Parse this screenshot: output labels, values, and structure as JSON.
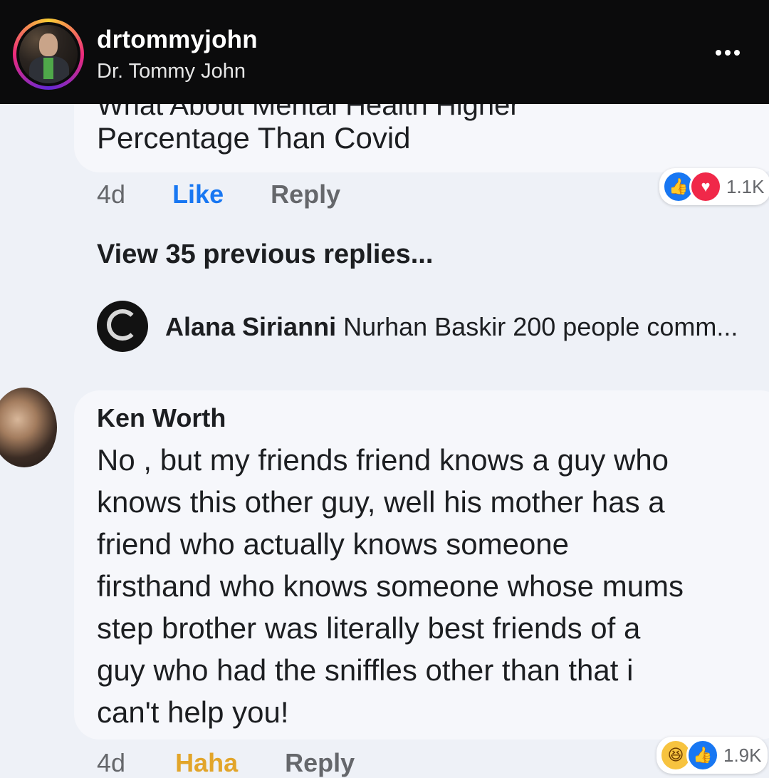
{
  "header": {
    "username": "drtommyjohn",
    "full_name": "Dr. Tommy John",
    "more_icon": "more-horizontal-icon"
  },
  "comment_top": {
    "cut_text": "What About Mental Health Higher",
    "text": "Percentage Than Covid",
    "time": "4d",
    "like_label": "Like",
    "reply_label": "Reply",
    "reaction_count": "1.1K",
    "reactions": [
      "like",
      "love"
    ]
  },
  "replies": {
    "view_previous": "View 35 previous replies..."
  },
  "reply_preview": {
    "author": "Alana Sirianni",
    "text": "Nurhan Baskir 200 people comm..."
  },
  "comment_ken": {
    "author": "Ken Worth",
    "lines": [
      "No ,  but my friends friend knows a guy who",
      "knows this other guy, well his mother has a",
      "friend who actually knows someone",
      "firsthand who knows someone whose mums",
      "step brother was literally best friends of a",
      "guy who had the sniffles other than that i",
      "can't help you!"
    ],
    "time": "4d",
    "haha_label": "Haha",
    "reply_label": "Reply",
    "reaction_count": "1.9K",
    "reactions": [
      "haha",
      "like"
    ]
  },
  "colors": {
    "header_bg": "#0b0b0c",
    "page_bg": "#eef1f7",
    "like_blue": "#1877f2",
    "haha_yellow": "#e2a52a"
  }
}
